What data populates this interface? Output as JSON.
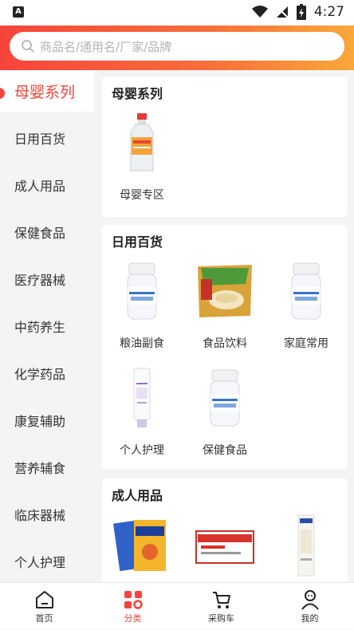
{
  "status": {
    "app_badge": "A",
    "time": "4:27"
  },
  "search": {
    "placeholder": "商品名/通用名/厂家/品牌"
  },
  "sidebar": {
    "items": [
      {
        "label": "母婴系列"
      },
      {
        "label": "日用百货"
      },
      {
        "label": "成人用品"
      },
      {
        "label": "保健食品"
      },
      {
        "label": "医疗器械"
      },
      {
        "label": "中药养生"
      },
      {
        "label": "化学药品"
      },
      {
        "label": "康复辅助"
      },
      {
        "label": "营养辅食"
      },
      {
        "label": "临床器械"
      },
      {
        "label": "个人护理"
      }
    ]
  },
  "sections": [
    {
      "title": "母婴系列",
      "items": [
        {
          "label": "母婴专区",
          "icon": "bottle-product-image"
        }
      ]
    },
    {
      "title": "日用百货",
      "items": [
        {
          "label": "粮油副食",
          "icon": "pill-bottle-image"
        },
        {
          "label": "食品饮料",
          "icon": "food-bag-image"
        },
        {
          "label": "家庭常用",
          "icon": "pill-bottle-image"
        },
        {
          "label": "个人护理",
          "icon": "tube-image"
        },
        {
          "label": "保健食品",
          "icon": "pill-bottle-image"
        }
      ]
    },
    {
      "title": "成人用品",
      "items": [
        {
          "label": "",
          "icon": "condom-box-image"
        },
        {
          "label": "",
          "icon": "red-box-image"
        },
        {
          "label": "",
          "icon": "white-box-image"
        }
      ]
    }
  ],
  "tabbar": {
    "items": [
      {
        "label": "首页",
        "icon": "home-icon"
      },
      {
        "label": "分类",
        "icon": "category-icon"
      },
      {
        "label": "采购车",
        "icon": "cart-icon"
      },
      {
        "label": "我的",
        "icon": "profile-icon"
      }
    ]
  },
  "colors": {
    "accent": "#f5443a",
    "header_start": "#f6443a",
    "header_end": "#f9a83a"
  }
}
